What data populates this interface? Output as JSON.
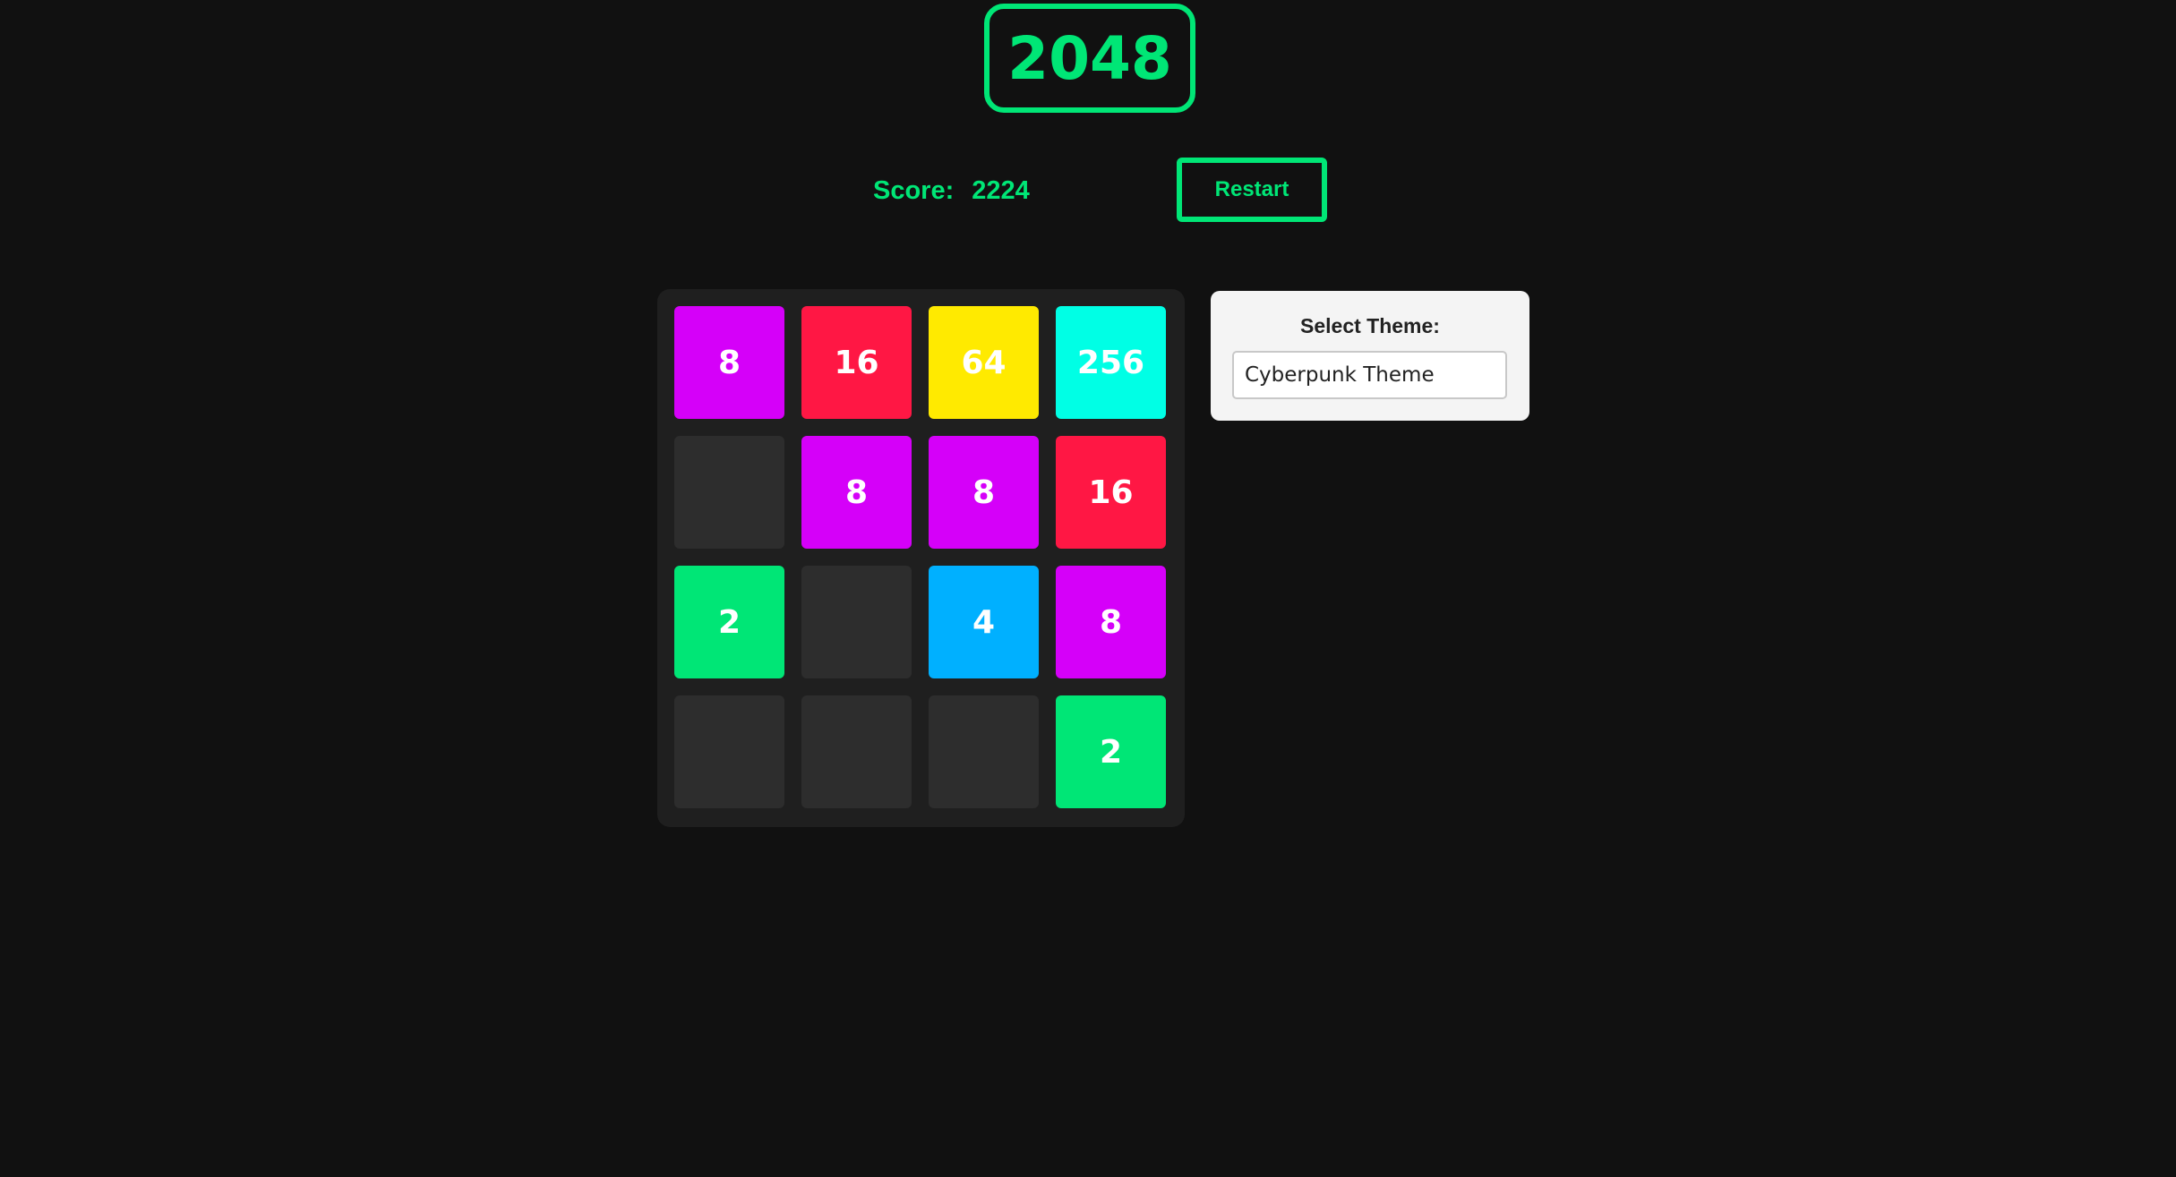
{
  "header": {
    "title": "2048"
  },
  "score": {
    "label": "Score:",
    "value": "2224"
  },
  "controls": {
    "restart_label": "Restart"
  },
  "theme": {
    "label": "Select Theme:",
    "selected": "Cyberpunk Theme"
  },
  "colors": {
    "accent": "#00e676",
    "background": "#111111",
    "board": "#1f1f1f",
    "empty_cell": "#2d2d2d",
    "tile_2": "#00e676",
    "tile_4": "#00b0ff",
    "tile_8": "#d500f9",
    "tile_16": "#ff1744",
    "tile_64": "#ffea00",
    "tile_256": "#00ffe5"
  },
  "board": {
    "rows": [
      [
        "8",
        "16",
        "64",
        "256"
      ],
      [
        "",
        "8",
        "8",
        "16"
      ],
      [
        "2",
        "",
        "4",
        "8"
      ],
      [
        "",
        "",
        "",
        "2"
      ]
    ]
  }
}
